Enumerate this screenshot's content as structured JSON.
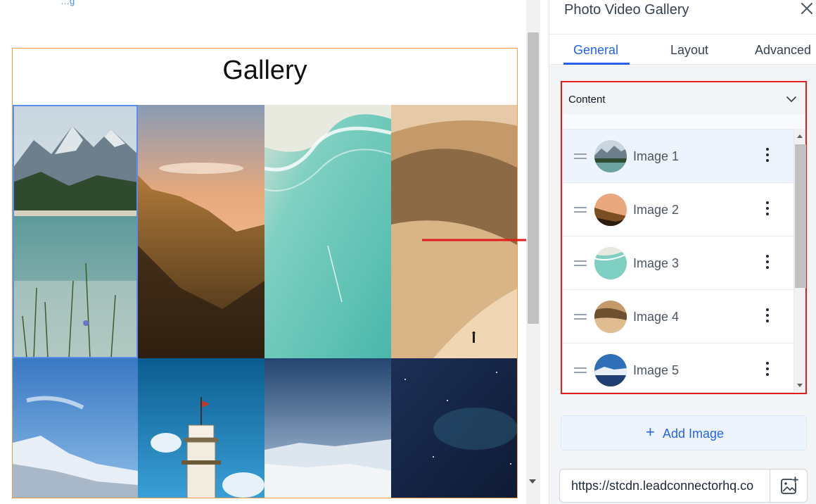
{
  "canvas": {
    "top_link": "…g",
    "gallery_title": "Gallery"
  },
  "panel": {
    "title": "Photo Video Gallery",
    "tabs": [
      {
        "label": "General",
        "active": true
      },
      {
        "label": "Layout",
        "active": false
      },
      {
        "label": "Advanced",
        "active": false
      }
    ],
    "content_section": {
      "label": "Content",
      "images": [
        {
          "label": "Image 1"
        },
        {
          "label": "Image 2"
        },
        {
          "label": "Image 3"
        },
        {
          "label": "Image 4"
        },
        {
          "label": "Image 5"
        }
      ]
    },
    "add_image_label": "Add Image",
    "add_image_icon": "plus-icon",
    "url_value": "https://stcdn.leadconnectorhq.co",
    "media_icon": "image-add-icon",
    "close_icon": "close-icon"
  },
  "colors": {
    "accent": "#2563eb",
    "highlight_border": "#e11d1d",
    "gallery_border": "#f0a040",
    "selected_tile": "#5b8def"
  }
}
